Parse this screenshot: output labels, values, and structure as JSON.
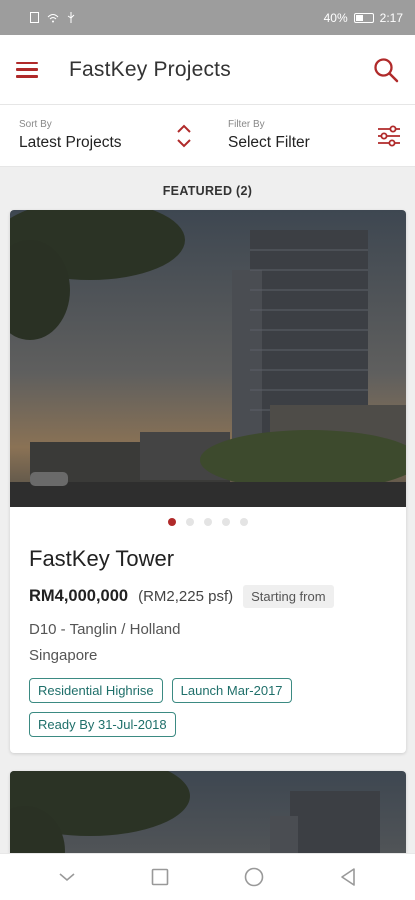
{
  "status": {
    "battery": "40%",
    "time": "2:17"
  },
  "appbar": {
    "title": "FastKey Projects"
  },
  "sort": {
    "label": "Sort By",
    "value": "Latest Projects"
  },
  "filter": {
    "label": "Filter By",
    "value": "Select Filter"
  },
  "featured": {
    "heading": "FEATURED (2)"
  },
  "listing": {
    "name": "FastKey Tower",
    "price": "RM4,000,000",
    "psf": "(RM2,225 psf)",
    "price_note": "Starting from",
    "district": "D10 - Tanglin / Holland",
    "country": "Singapore",
    "tags": [
      "Residential Highrise",
      "Launch Mar-2017",
      "Ready By 31-Jul-2018"
    ],
    "image_count": 5,
    "active_image": 1
  },
  "colors": {
    "accent": "#b02a2a",
    "tag": "#3b8a82"
  },
  "icons": {
    "menu": "hamburger-icon",
    "search": "search-icon",
    "sort": "sort-arrows-icon",
    "filter": "sliders-icon",
    "nav_back": "triangle-back-icon",
    "nav_home": "circle-home-icon",
    "nav_recent": "square-recent-icon",
    "nav_hide": "chevron-down-icon"
  }
}
